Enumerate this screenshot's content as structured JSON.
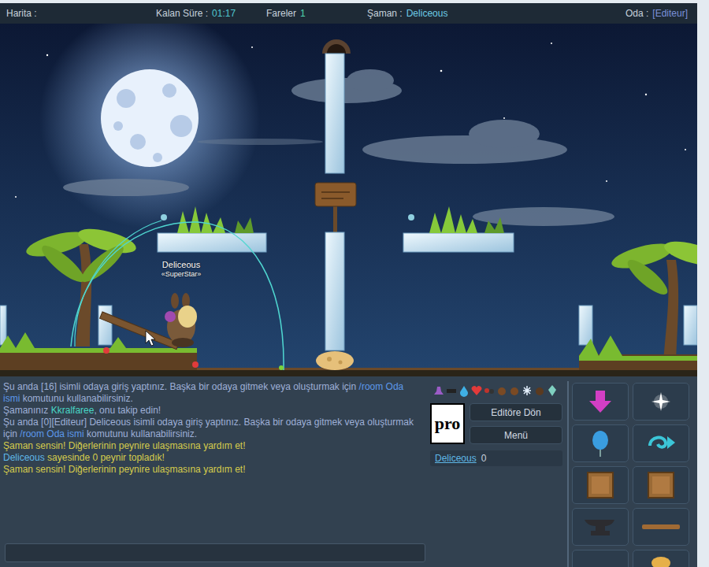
{
  "hud": [
    {
      "label": "Harita :"
    },
    {
      "label": "Kalan Süre :",
      "value": "01:17"
    },
    {
      "label": "Fareler",
      "value": "1"
    },
    {
      "label": "Şaman :",
      "value": "Deliceous"
    },
    {
      "label": "Oda :",
      "value": "[Editeur]"
    }
  ],
  "player": {
    "name": "Deliceous",
    "title": "«SuperStar»"
  },
  "chat": [
    {
      "segments": [
        {
          "text": "Şu anda [16] isimli odaya giriş yaptınız. Başka bir odaya gitmek veya oluşturmak için ",
          "kind": "system"
        },
        {
          "text": "/room Oda ismi",
          "kind": "link"
        },
        {
          "text": " komutunu kullanabilirsiniz.",
          "kind": "system"
        }
      ]
    },
    {
      "segments": [
        {
          "text": "Şamanınız ",
          "kind": "system"
        },
        {
          "text": "Kkralfaree",
          "kind": "name"
        },
        {
          "text": ", onu takip edin!",
          "kind": "system"
        }
      ]
    },
    {
      "segments": [
        {
          "text": "Şu anda [0][Editeur] Deliceous isimli odaya giriş yaptınız. Başka bir odaya gitmek veya oluşturmak için ",
          "kind": "system"
        },
        {
          "text": "/room Oda ismi",
          "kind": "link"
        },
        {
          "text": " komutunu kullanabilirsiniz.",
          "kind": "system"
        }
      ]
    },
    {
      "segments": [
        {
          "text": "Şaman sensin! Diğerlerinin peynire ulaşmasına yardım et!",
          "kind": "event"
        }
      ]
    },
    {
      "segments": [
        {
          "text": "Deliceous",
          "kind": "player"
        },
        {
          "text": " sayesinde 0 peynir topladık!",
          "kind": "event"
        }
      ]
    },
    {
      "segments": [
        {
          "text": "Şaman sensin! Diğerlerinin peynire ulaşmasına yardım et!",
          "kind": "event"
        }
      ]
    }
  ],
  "shaman_items": [
    {
      "kind": "hat"
    },
    {
      "kind": "bar"
    },
    {
      "kind": "drop"
    },
    {
      "kind": "heart"
    },
    {
      "kind": "dots"
    },
    {
      "kind": "acorn"
    },
    {
      "kind": "acorn"
    },
    {
      "kind": "flake"
    },
    {
      "kind": "nut"
    },
    {
      "kind": "crystal"
    }
  ],
  "side": {
    "badge": "pro",
    "buttons": [
      "Editöre Dön",
      "Menü"
    ],
    "players": [
      {
        "name": "Deliceous",
        "score": "0",
        "selected": false
      }
    ]
  },
  "tools": [
    {
      "kind": "arrow"
    },
    {
      "kind": "sparkle"
    },
    {
      "kind": "balloon"
    },
    {
      "kind": "swirl"
    },
    {
      "kind": "crate"
    },
    {
      "kind": "crate"
    },
    {
      "kind": "anvil"
    },
    {
      "kind": "plank"
    },
    {
      "kind": "blank"
    },
    {
      "kind": "cheese"
    }
  ]
}
